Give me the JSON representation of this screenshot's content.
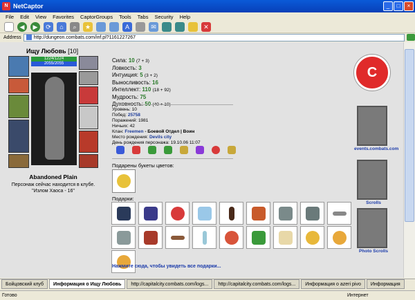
{
  "window": {
    "title": "NetCaptor",
    "min": "_",
    "max": "□",
    "close": "×"
  },
  "menu": [
    "File",
    "Edit",
    "View",
    "Favorites",
    "CaptorGroups",
    "Tools",
    "Tabs",
    "Security",
    "Help"
  ],
  "address": {
    "label": "Address",
    "url": "http://dungeon.combats.com/inf.pl?1161227267"
  },
  "profile": {
    "name": "Ищу Любовь",
    "level": "[10]",
    "hp": "1224/1224",
    "mp": "2055/2055",
    "location": "Abandoned Plain",
    "note_line1": "Персонаж сейчас находится в клубе.",
    "note_line2": "\"Излом Хаоса - 16\"",
    "stats": [
      {
        "label": "Сила:",
        "value": "10",
        "bonus": "(7 + 3)"
      },
      {
        "label": "Ловкость:",
        "value": "3",
        "bonus": ""
      },
      {
        "label": "Интуиция:",
        "value": "5",
        "bonus": "(3 + 2)"
      },
      {
        "label": "Выносливость:",
        "value": "16",
        "bonus": ""
      },
      {
        "label": "Интеллект:",
        "value": "110",
        "bonus": "(18 + 92)"
      },
      {
        "label": "Мудрость:",
        "value": "75",
        "bonus": ""
      },
      {
        "label": "Духовность:",
        "value": "50",
        "bonus": "(40 + 10)"
      }
    ],
    "info": {
      "level_line": "Уровень: 10",
      "wins_label": "Побед:",
      "wins": "25758",
      "losses_line": "Поражений: 1981",
      "draws_line": "Ничьих: 42",
      "clan_label": "Клан:",
      "clan": "Freemen",
      "clan_rest": " - Боевой Отдел | Воин",
      "birthplace_label": "Место рождения:",
      "birthplace": "Devils city",
      "birthday_line": "День рождения персонажа: 19.10.06 11:07"
    },
    "bouquets_title": "Подарены букеты цветов:",
    "gifts_title": "Подарки:",
    "gifts_link": "Нажмите сюда, чтобы увидеть все подарки..."
  },
  "side": {
    "logo_letter": "C",
    "link1": "events.combats.com",
    "link2": "Scrolls",
    "link3": "Photo Scrolls"
  },
  "tabs": [
    "Бойцовский клуб",
    "Информация о Ищу Любовь",
    "http://capitalcity.combats.com/logs...",
    "http://capitalcity.combats.com/logs...",
    "Информация о azeri pivo",
    "Информация"
  ],
  "status": {
    "left": "Готово",
    "zone": "Интернет"
  },
  "colors": {
    "title": "#0a5ad8",
    "stat": "#2a7a2a",
    "link": "#1a3aaa",
    "logo": "#e02a2a"
  }
}
